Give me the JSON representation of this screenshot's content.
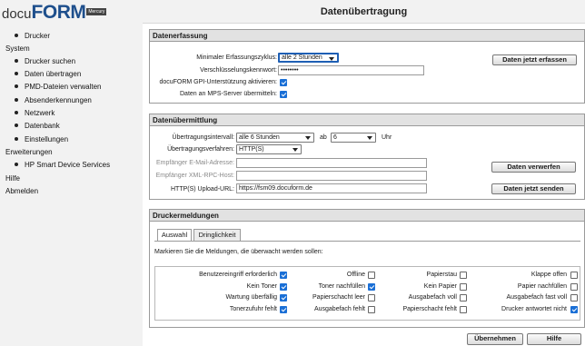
{
  "logo": {
    "part1": "docu",
    "part2": "FORM",
    "badge": "Mercury"
  },
  "nav": {
    "drucker": "Drucker",
    "system": "System",
    "drucker_suchen": "Drucker suchen",
    "daten_uebertragen": "Daten übertragen",
    "pmd_dateien": "PMD-Dateien verwalten",
    "absenderkennungen": "Absenderkennungen",
    "netzwerk": "Netzwerk",
    "datenbank": "Datenbank",
    "einstellungen": "Einstellungen",
    "erweiterungen": "Erweiterungen",
    "hp_smart": "HP Smart Device Services",
    "hilfe": "Hilfe",
    "abmelden": "Abmelden"
  },
  "page_title": "Datenübertragung",
  "erfassung": {
    "title": "Datenerfassung",
    "zyklus_label": "Minimaler Erfassungszyklus:",
    "zyklus_value": "alle 2 Stunden",
    "kennwort_label": "Verschlüsselungskennwort:",
    "kennwort_value": "••••••••",
    "gpi_label": "docuFORM GPI-Unterstützung aktivieren:",
    "gpi_checked": true,
    "mps_label": "Daten an MPS-Server übermitteln:",
    "mps_checked": true,
    "button": "Daten jetzt erfassen"
  },
  "uebermittlung": {
    "title": "Datenübermittlung",
    "intervall_label": "Übertragungsintervall:",
    "intervall_value": "alle 6 Stunden",
    "ab_label": "ab",
    "ab_value": "6",
    "uhr_label": "Uhr",
    "verfahren_label": "Übertragungsverfahren:",
    "verfahren_value": "HTTP(S)",
    "email_label": "Empfänger E-Mail-Adresse:",
    "email_value": "",
    "xmlrpc_label": "Empfänger XML-RPC-Host:",
    "xmlrpc_value": "",
    "upload_label": "HTTP(S) Upload-URL:",
    "upload_value": "https://fsm09.docuform.de",
    "btn_verwerfen": "Daten verwerfen",
    "btn_senden": "Daten jetzt senden"
  },
  "meldungen": {
    "title": "Druckermeldungen",
    "tabs": [
      "Auswahl",
      "Dringlichkeit"
    ],
    "instruction": "Markieren Sie die Meldungen, die überwacht werden sollen:",
    "rows": [
      [
        {
          "label": "Benutzereingriff erforderlich",
          "checked": true
        },
        {
          "label": "Offline",
          "checked": false
        },
        {
          "label": "Papierstau",
          "checked": false
        },
        {
          "label": "Klappe offen",
          "checked": false
        }
      ],
      [
        {
          "label": "Kein Toner",
          "checked": true
        },
        {
          "label": "Toner nachfüllen",
          "checked": true
        },
        {
          "label": "Kein Papier",
          "checked": false
        },
        {
          "label": "Papier nachfüllen",
          "checked": false
        }
      ],
      [
        {
          "label": "Wartung überfällig",
          "checked": true
        },
        {
          "label": "Papierschacht leer",
          "checked": false
        },
        {
          "label": "Ausgabefach voll",
          "checked": false
        },
        {
          "label": "Ausgabefach fast voll",
          "checked": false
        }
      ],
      [
        {
          "label": "Tonerzufuhr fehlt",
          "checked": true
        },
        {
          "label": "Ausgabefach fehlt",
          "checked": false
        },
        {
          "label": "Papierschacht fehlt",
          "checked": false
        },
        {
          "label": "Drucker antwortet nicht",
          "checked": true
        }
      ]
    ]
  },
  "footer": {
    "uebernehmen": "Übernehmen",
    "hilfe": "Hilfe"
  }
}
